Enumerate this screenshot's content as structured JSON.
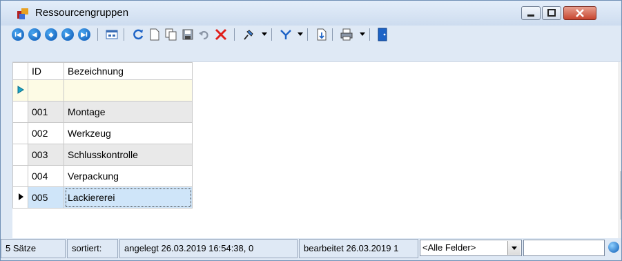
{
  "window": {
    "title": "Ressourcengruppen",
    "title_icon": "resource-groups-icon",
    "controls": [
      "minimize-icon",
      "maximize-icon",
      "close-icon"
    ]
  },
  "toolbar": {
    "nav": [
      "first-record-icon",
      "previous-record-icon",
      "goto-record-icon",
      "next-record-icon",
      "last-record-icon"
    ],
    "nav_glyphs": [
      "I◀",
      "◀",
      "◆",
      "▶",
      "▶I"
    ],
    "actions": [
      "grid-view-icon",
      "refresh-icon",
      "new-record-icon",
      "copy-record-icon",
      "save-icon",
      "undo-icon",
      "delete-icon",
      "pin-icon",
      "filter-icon",
      "export-icon",
      "print-icon",
      "exit-icon"
    ]
  },
  "grid": {
    "columns": [
      "ID",
      "Bezeichnung"
    ],
    "rows": [
      {
        "id": "",
        "name": "",
        "state": "new"
      },
      {
        "id": "001",
        "name": "Montage",
        "state": ""
      },
      {
        "id": "002",
        "name": "Werkzeug",
        "state": ""
      },
      {
        "id": "003",
        "name": "Schlusskontrolle",
        "state": ""
      },
      {
        "id": "004",
        "name": "Verpackung",
        "state": ""
      },
      {
        "id": "005",
        "name": "Lackiererei",
        "state": "selected"
      }
    ]
  },
  "status": {
    "count": "5 Sätze",
    "sorted": "sortiert:",
    "created": "angelegt 26.03.2019 16:54:38,  0",
    "edited": "bearbeitet 26.03.2019 1",
    "field_selector": "<Alle Felder>",
    "search_value": ""
  },
  "colors": {
    "chrome": "#dfe9f5",
    "new_row": "#fdfbe5",
    "selected_row": "#cfe5f9",
    "alt_row": "#e9e9e9",
    "close_button": "#c7452f",
    "new_row_indicator": "#1aa6c9"
  }
}
